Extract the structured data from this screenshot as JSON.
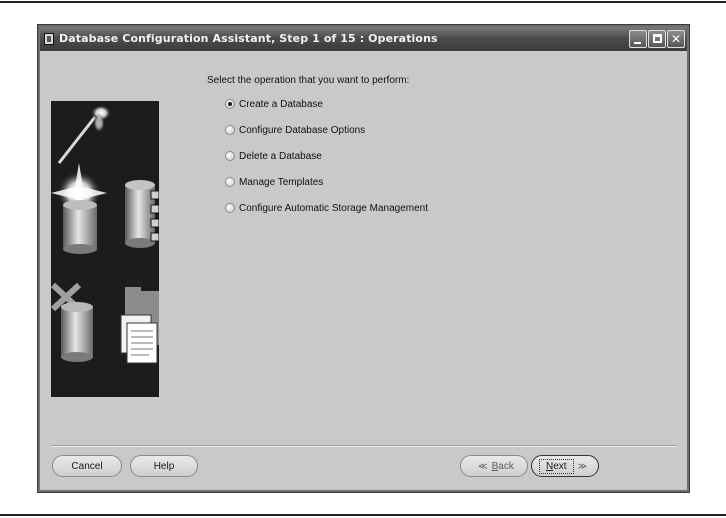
{
  "window": {
    "title": "Database Configuration Assistant, Step 1 of 15 : Operations",
    "controls": {
      "minimize": "minimize-icon",
      "maximize": "maximize-icon",
      "close": "✕"
    }
  },
  "operations": {
    "prompt": "Select the operation that you want to perform:",
    "options": [
      {
        "label": "Create a Database",
        "selected": true
      },
      {
        "label": "Configure Database Options",
        "selected": false
      },
      {
        "label": "Delete a Database",
        "selected": false
      },
      {
        "label": "Manage Templates",
        "selected": false
      },
      {
        "label": "Configure Automatic Storage Management",
        "selected": false
      }
    ]
  },
  "buttons": {
    "cancel": "Cancel",
    "help": "Help",
    "back": "Back",
    "next": "Next",
    "back_arrow": "≪",
    "next_arrow": "≫"
  },
  "colors": {
    "dialog_background": "#c9c9c9",
    "titlebar": "#4d4d4d",
    "illustration_background": "#1c1c1c"
  }
}
